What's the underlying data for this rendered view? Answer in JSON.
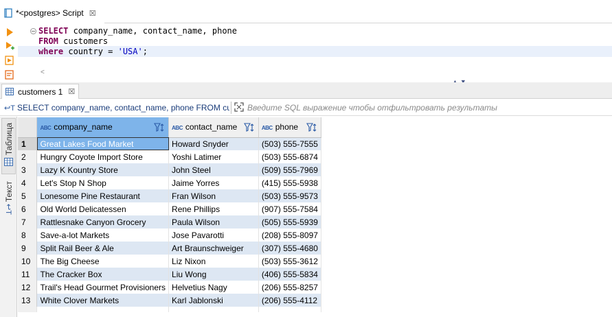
{
  "editor_tab": {
    "title": "*<postgres> Script",
    "close": "☒"
  },
  "editor": {
    "lines": [
      {
        "kw": "SELECT",
        "rest": " company_name, contact_name, phone"
      },
      {
        "kw": "FROM",
        "rest": " customers"
      },
      {
        "kw": "where",
        "rest": " country = ",
        "str": "'USA'",
        "end": ";"
      }
    ],
    "scroll_left": "<",
    "split_arrows": "▲▼"
  },
  "result_tab": {
    "label": "customers 1",
    "close": "☒"
  },
  "filter": {
    "query_text": "SELECT company_name, contact_name, phone FROM cus",
    "placeholder": "Введите SQL выражение чтобы отфильтровать результаты"
  },
  "side_tabs": {
    "table_label": "Таблица",
    "text_label": "Текст"
  },
  "grid": {
    "type_badge": "ABC",
    "columns": [
      "company_name",
      "contact_name",
      "phone"
    ],
    "rows": [
      [
        "1",
        "Great Lakes Food Market",
        "Howard Snyder",
        "(503) 555-7555"
      ],
      [
        "2",
        "Hungry Coyote Import Store",
        "Yoshi Latimer",
        "(503) 555-6874"
      ],
      [
        "3",
        "Lazy K Kountry Store",
        "John Steel",
        "(509) 555-7969"
      ],
      [
        "4",
        "Let's Stop N Shop",
        "Jaime Yorres",
        "(415) 555-5938"
      ],
      [
        "5",
        "Lonesome Pine Restaurant",
        "Fran Wilson",
        "(503) 555-9573"
      ],
      [
        "6",
        "Old World Delicatessen",
        "Rene Phillips",
        "(907) 555-7584"
      ],
      [
        "7",
        "Rattlesnake Canyon Grocery",
        "Paula Wilson",
        "(505) 555-5939"
      ],
      [
        "8",
        "Save-a-lot Markets",
        "Jose Pavarotti",
        "(208) 555-8097"
      ],
      [
        "9",
        "Split Rail Beer & Ale",
        "Art Braunschweiger",
        "(307) 555-4680"
      ],
      [
        "10",
        "The Big Cheese",
        "Liz Nixon",
        "(503) 555-3612"
      ],
      [
        "11",
        "The Cracker Box",
        "Liu Wong",
        "(406) 555-5834"
      ],
      [
        "12",
        "Trail's Head Gourmet Provisioners",
        "Helvetius Nagy",
        "(206) 555-8257"
      ],
      [
        "13",
        "White Clover Markets",
        "Karl Jablonski",
        "(206) 555-4112"
      ]
    ]
  },
  "colors": {
    "selection": "#7eb4ea",
    "row_alt": "#dde7f3",
    "keyword": "#7f0055",
    "string": "#0000c0"
  }
}
